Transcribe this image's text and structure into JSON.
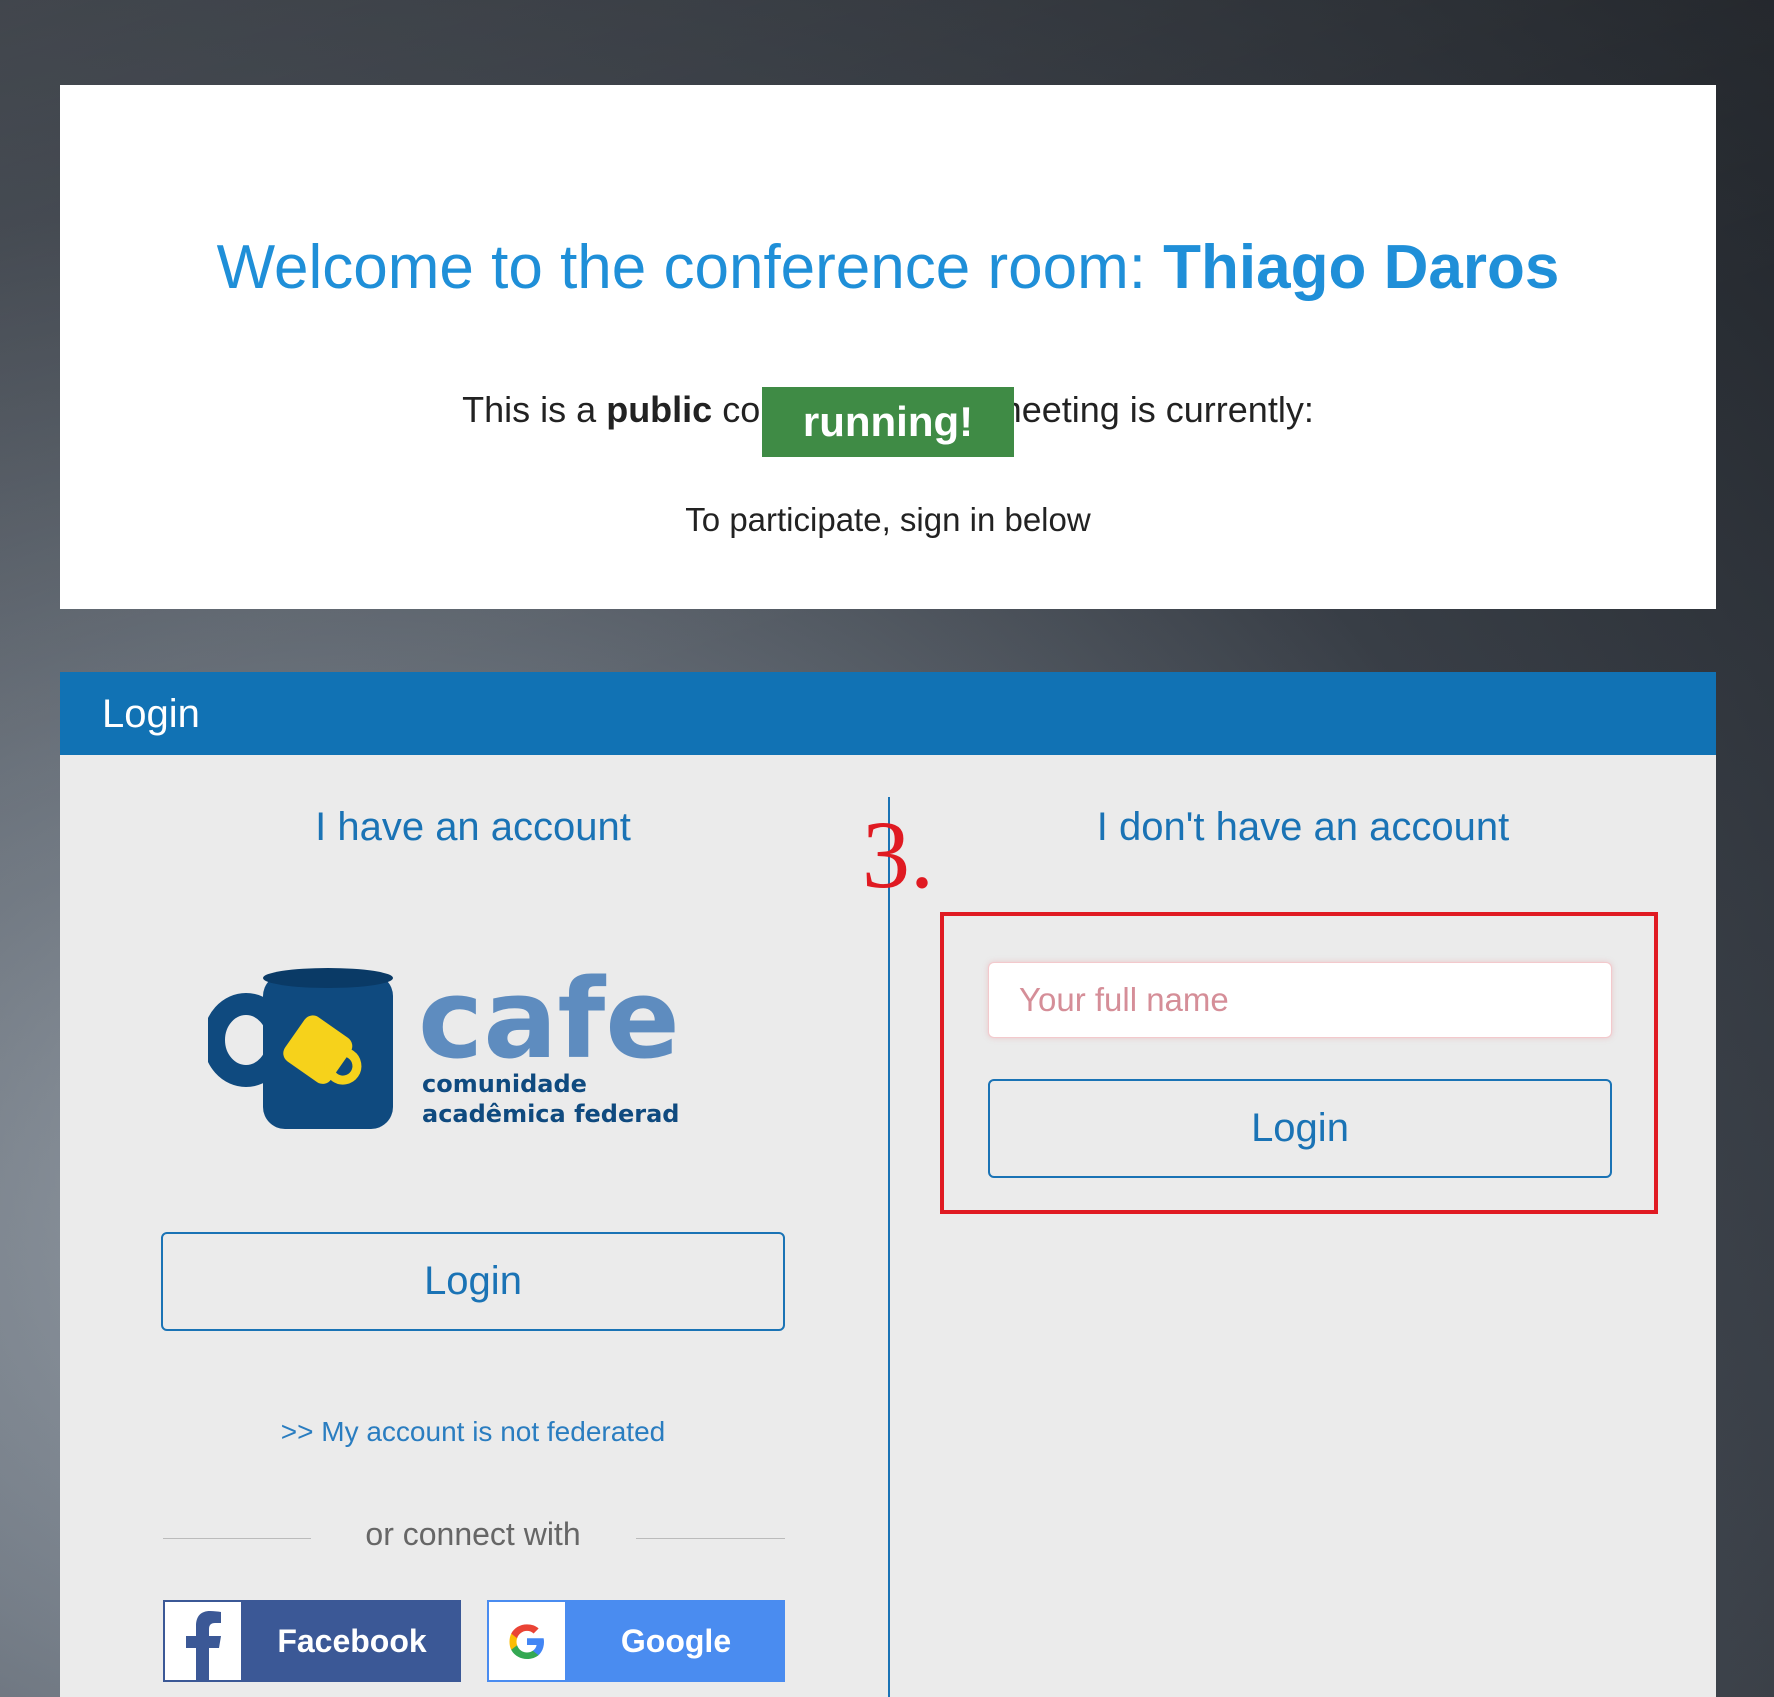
{
  "welcome": {
    "title_prefix": "Welcome to the conference room: ",
    "room_name": "Thiago Daros",
    "intro_prefix": "This is a ",
    "intro_bold": "public",
    "intro_suffix": " conference. The meeting is currently:",
    "status": "running!",
    "status_color": "#3f8b45",
    "sign_in_note": "To participate, sign in below"
  },
  "login": {
    "header": "Login",
    "left": {
      "heading": "I have an account",
      "logo": {
        "name": "cafe",
        "line1": "comunidade",
        "line2": "acadêmica federada"
      },
      "login_button": "Login",
      "not_federated_link": ">> My account is not federated",
      "or_connect": "or connect with",
      "facebook": "Facebook",
      "google": "Google"
    },
    "right": {
      "heading": "I don't have an account",
      "name_placeholder": "Your full name",
      "login_button": "Login"
    },
    "step_marker": "3."
  },
  "colors": {
    "accent": "#1a73b5",
    "title": "#1f8fd8",
    "header_bar": "#1172b4",
    "highlight": "#e01a22",
    "facebook": "#3b5896",
    "google": "#4a8cf0"
  }
}
